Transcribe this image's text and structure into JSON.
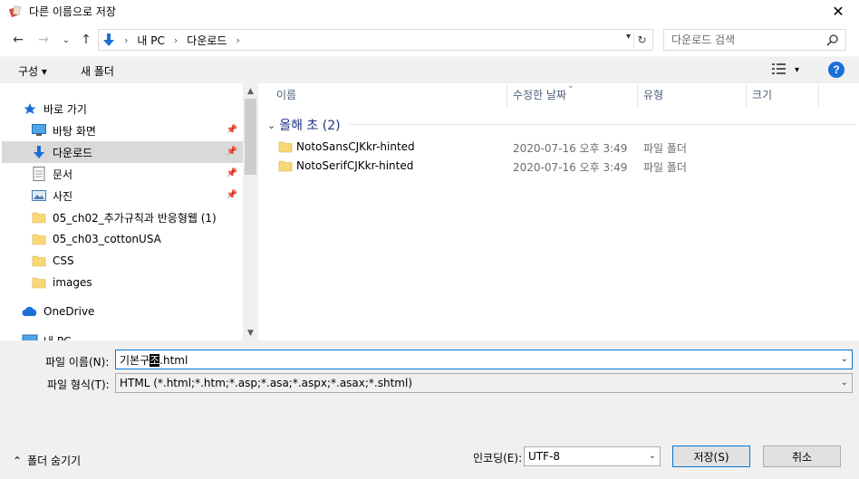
{
  "window": {
    "title": "다른 이름으로 저장",
    "close_glyph": "✕"
  },
  "nav": {
    "back_glyph": "←",
    "forward_glyph": "→",
    "recent_glyph": "⌄",
    "up_glyph": "↑",
    "breadcrumb": [
      "내 PC",
      "다운로드"
    ],
    "search_placeholder": "다운로드 검색"
  },
  "toolbar": {
    "organize_label": "구성 ▾",
    "new_folder_label": "새 폴더",
    "view_glyph": "▾",
    "help_label": "?"
  },
  "sidebar": {
    "items": [
      {
        "label": "바로 가기",
        "icon": "star-icon"
      },
      {
        "label": "바탕 화면",
        "icon": "desktop-icon",
        "pinned": true
      },
      {
        "label": "다운로드",
        "icon": "download-icon",
        "pinned": true,
        "selected": true
      },
      {
        "label": "문서",
        "icon": "document-icon",
        "pinned": true
      },
      {
        "label": "사진",
        "icon": "pictures-icon",
        "pinned": true
      },
      {
        "label": "05_ch02_추가규칙과 반응형웹 (1)",
        "icon": "folder-icon"
      },
      {
        "label": "05_ch03_cottonUSA",
        "icon": "folder-icon"
      },
      {
        "label": "CSS",
        "icon": "folder-icon"
      },
      {
        "label": "images",
        "icon": "folder-icon"
      },
      {
        "label": "OneDrive",
        "icon": "cloud-icon"
      },
      {
        "label": "내 PC",
        "icon": "pc-icon"
      }
    ]
  },
  "columns": {
    "name": "이름",
    "date": "수정한 날짜",
    "type": "유형",
    "size": "크기"
  },
  "group": {
    "label": "올해 초 (2)",
    "chevron": "⌄"
  },
  "files": [
    {
      "name": "NotoSansCJKkr-hinted",
      "date": "2020-07-16 오후 3:49",
      "type": "파일 폴더"
    },
    {
      "name": "NotoSerifCJKkr-hinted",
      "date": "2020-07-16 오후 3:49",
      "type": "파일 폴더"
    }
  ],
  "form": {
    "filename_label": "파일 이름(N):",
    "filename_prefix": "기본구",
    "filename_selected": "조",
    "filename_suffix": ".html",
    "filetype_label": "파일 형식(T):",
    "filetype_value": "HTML (*.html;*.htm;*.asp;*.asa;*.aspx;*.asax;*.shtml)",
    "encoding_label": "인코딩(E):",
    "encoding_value": "UTF-8",
    "save_label": "저장(S)",
    "cancel_label": "취소",
    "hide_folders_label": "폴더 숨기기",
    "hide_folders_glyph": "⌃"
  },
  "colors": {
    "accent": "#0078d7",
    "folder": "#f8d775",
    "download_arrow": "#1a6fd6",
    "group_header": "#1e3287"
  }
}
